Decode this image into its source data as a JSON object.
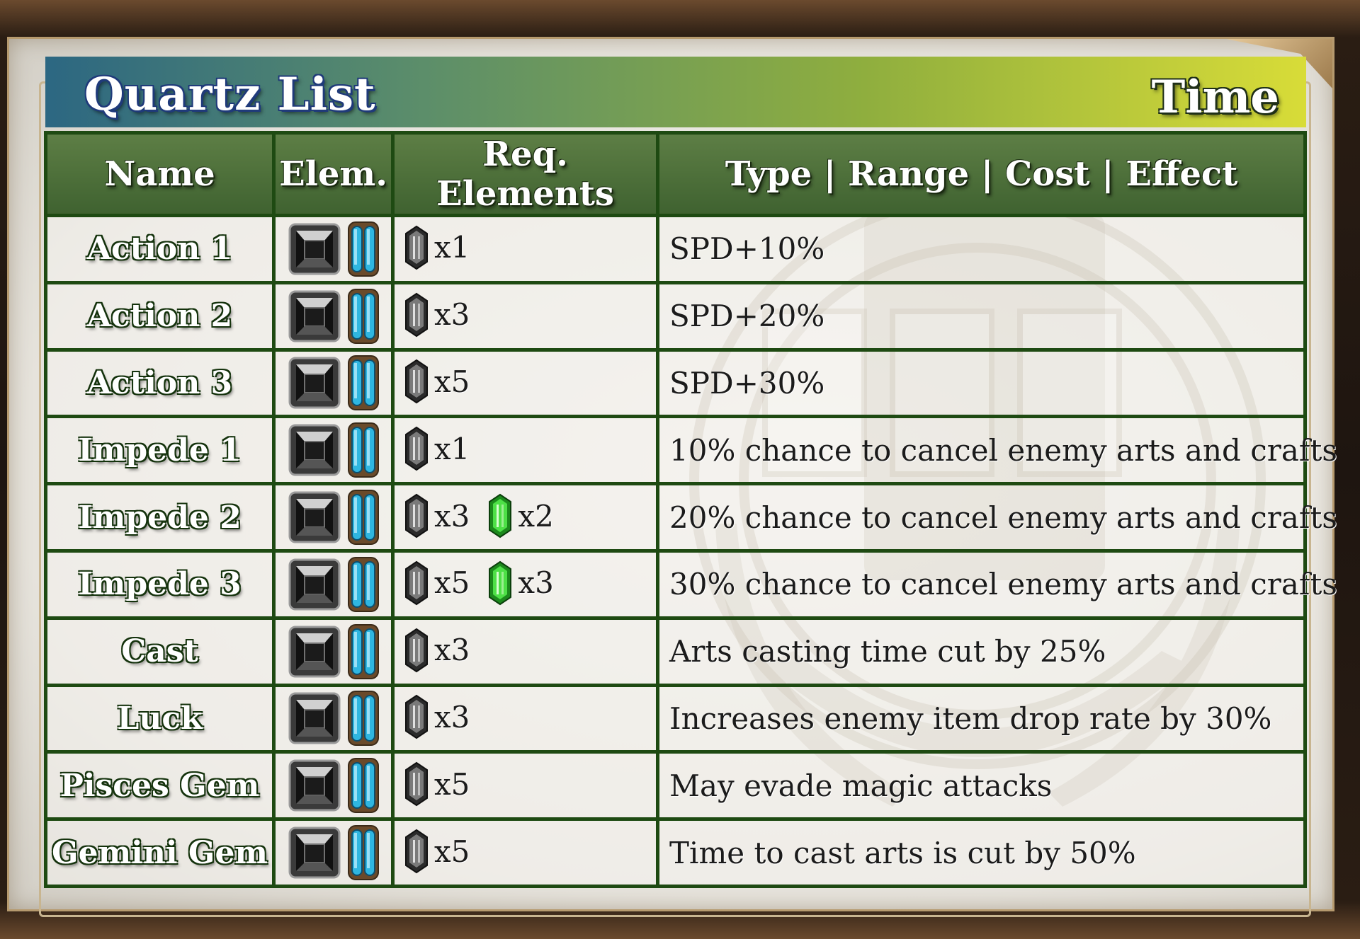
{
  "title": "Quartz List",
  "element_category": "Time",
  "headers": {
    "name": "Name",
    "elem": "Elem.",
    "req": "Req. Elements",
    "effect": "Type | Range | Cost | Effect"
  },
  "icons": {
    "quartz_element": "black-time-quartz-icon",
    "slot": "blue-slot-icon",
    "time_gem": "time-gem-icon",
    "wind_gem": "wind-gem-icon"
  },
  "colors": {
    "title_gradient_start": "#2c6782",
    "title_gradient_end": "#d8dc38",
    "table_border": "#1e4a12",
    "header_bg": "#4f7038",
    "slot_blue": "#2fb6e0",
    "wind_green": "#3fcf3a"
  },
  "rows": [
    {
      "name": "Action 1",
      "req": [
        {
          "gem": "time",
          "count": "x1"
        }
      ],
      "effect": "SPD+10%"
    },
    {
      "name": "Action 2",
      "req": [
        {
          "gem": "time",
          "count": "x3"
        }
      ],
      "effect": "SPD+20%"
    },
    {
      "name": "Action 3",
      "req": [
        {
          "gem": "time",
          "count": "x5"
        }
      ],
      "effect": "SPD+30%"
    },
    {
      "name": "Impede 1",
      "req": [
        {
          "gem": "time",
          "count": "x1"
        }
      ],
      "effect": "10% chance to cancel enemy arts and crafts"
    },
    {
      "name": "Impede 2",
      "req": [
        {
          "gem": "time",
          "count": "x3"
        },
        {
          "gem": "wind",
          "count": "x2"
        }
      ],
      "effect": "20% chance to cancel enemy arts and crafts"
    },
    {
      "name": "Impede 3",
      "req": [
        {
          "gem": "time",
          "count": "x5"
        },
        {
          "gem": "wind",
          "count": "x3"
        }
      ],
      "effect": "30% chance to cancel enemy arts and crafts"
    },
    {
      "name": "Cast",
      "req": [
        {
          "gem": "time",
          "count": "x3"
        }
      ],
      "effect": "Arts casting time cut by 25%"
    },
    {
      "name": "Luck",
      "req": [
        {
          "gem": "time",
          "count": "x3"
        }
      ],
      "effect": "Increases enemy item drop rate by 30%"
    },
    {
      "name": "Pisces Gem",
      "req": [
        {
          "gem": "time",
          "count": "x5"
        }
      ],
      "effect": "May evade magic attacks"
    },
    {
      "name": "Gemini Gem",
      "req": [
        {
          "gem": "time",
          "count": "x5"
        }
      ],
      "effect": "Time to cast arts is cut by 50%"
    }
  ]
}
